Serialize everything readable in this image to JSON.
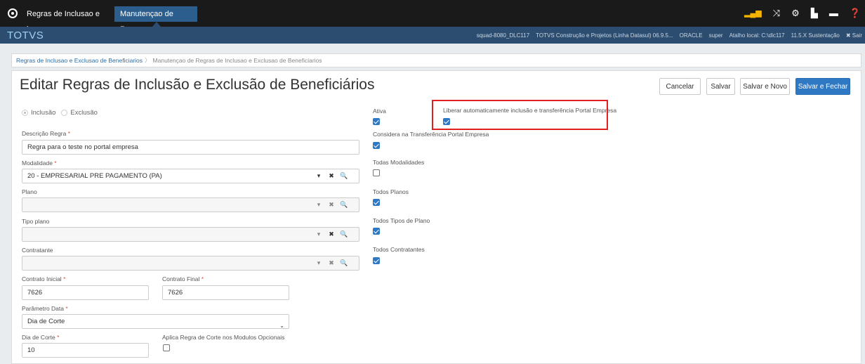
{
  "tabs": [
    {
      "label": "Regras de Inclusao e l",
      "close": "x"
    },
    {
      "label": "Manutençao de Regra",
      "close": "x"
    }
  ],
  "header": {
    "brand": "TOTVS",
    "info": [
      "squad-8080_DLC117",
      "TOTVS Construção e Projetos (Linha Datasul) 06.9.5...",
      "ORACLE",
      "super",
      "Atalho local: C:\\dlc117",
      "11.5.X Sustentação",
      "✖ Sair"
    ]
  },
  "breadcrumb": {
    "link": "Regras de Inclusao e Exclusao de Beneficiarios",
    "separator": "〉",
    "current": "Manutençao de Regras de Inclusao e Exclusao de Beneficiarios"
  },
  "page": {
    "title": "Editar Regras de Inclusão e Exclusão de Beneficiários",
    "buttons": {
      "cancel": "Cancelar",
      "save": "Salvar",
      "save_new": "Salvar e Novo",
      "save_close": "Salvar e Fechar"
    }
  },
  "form": {
    "radio": {
      "inclusao": "Inclusão",
      "exclusao": "Exclusão",
      "selected": "Inclusão"
    },
    "descricao": {
      "label": "Descrição Regra",
      "required": "*",
      "value": "Regra para o teste no portal empresa"
    },
    "modalidade": {
      "label": "Modalidade",
      "required": "*",
      "value": "20 - EMPRESARIAL PRE PAGAMENTO (PA)"
    },
    "plano": {
      "label": "Plano",
      "value": ""
    },
    "tipo_plano": {
      "label": "Tipo plano",
      "value": ""
    },
    "contratante": {
      "label": "Contratante",
      "value": ""
    },
    "contrato_inicial": {
      "label": "Contrato Inicial",
      "required": "*",
      "value": "7626"
    },
    "contrato_final": {
      "label": "Contrato Final",
      "required": "*",
      "value": "7626"
    },
    "parametro_data": {
      "label": "Parâmetro Data",
      "required": "*",
      "value": "Dia de Corte"
    },
    "dia_corte": {
      "label": "Dia de Corte",
      "required": "*",
      "value": "10"
    },
    "aplica_regra": {
      "label": "Aplica Regra de Corte nos Modulos Opcionais",
      "checked": false
    }
  },
  "checkboxes": {
    "ativa": {
      "label": "Ativa",
      "checked": true
    },
    "liberar": {
      "label": "Liberar automaticamente inclusão e transferência Portal Empresa",
      "checked": true
    },
    "considera": {
      "label": "Considera na Transferência Portal Empresa",
      "checked": true
    },
    "todas_modalidades": {
      "label": "Todas Modalidades",
      "checked": false
    },
    "todos_planos": {
      "label": "Todos Planos",
      "checked": true
    },
    "todos_tipos": {
      "label": "Todos Tipos de Plano",
      "checked": true
    },
    "todos_contratantes": {
      "label": "Todos Contratantes",
      "checked": true
    }
  },
  "icons": {
    "caret": "▾",
    "clear": "✖",
    "search": "🔍"
  },
  "colors": {
    "primary": "#2f78c4",
    "header": "#2d4d70",
    "highlight": "#e02020"
  }
}
